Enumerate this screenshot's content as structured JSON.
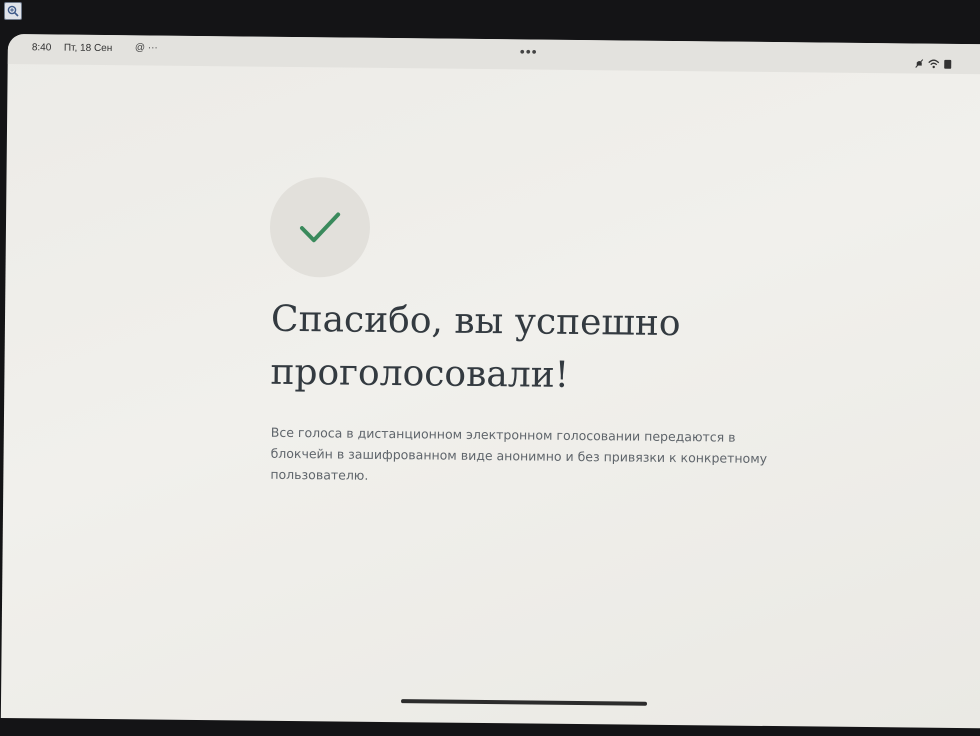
{
  "status_bar": {
    "time": "8:40",
    "date": "Пт, 18 Сен",
    "notifications": "@ ···",
    "center_dots": "•••"
  },
  "success": {
    "icon": "checkmark-icon",
    "accent_color": "#3a8a5c",
    "title": "Спасибо, вы успешно проголосовали!",
    "description": "Все голоса в дистанционном электронном голосовании передаются в блокчейн в зашифрованном виде анонимно и без привязки к конкретному пользователю."
  }
}
